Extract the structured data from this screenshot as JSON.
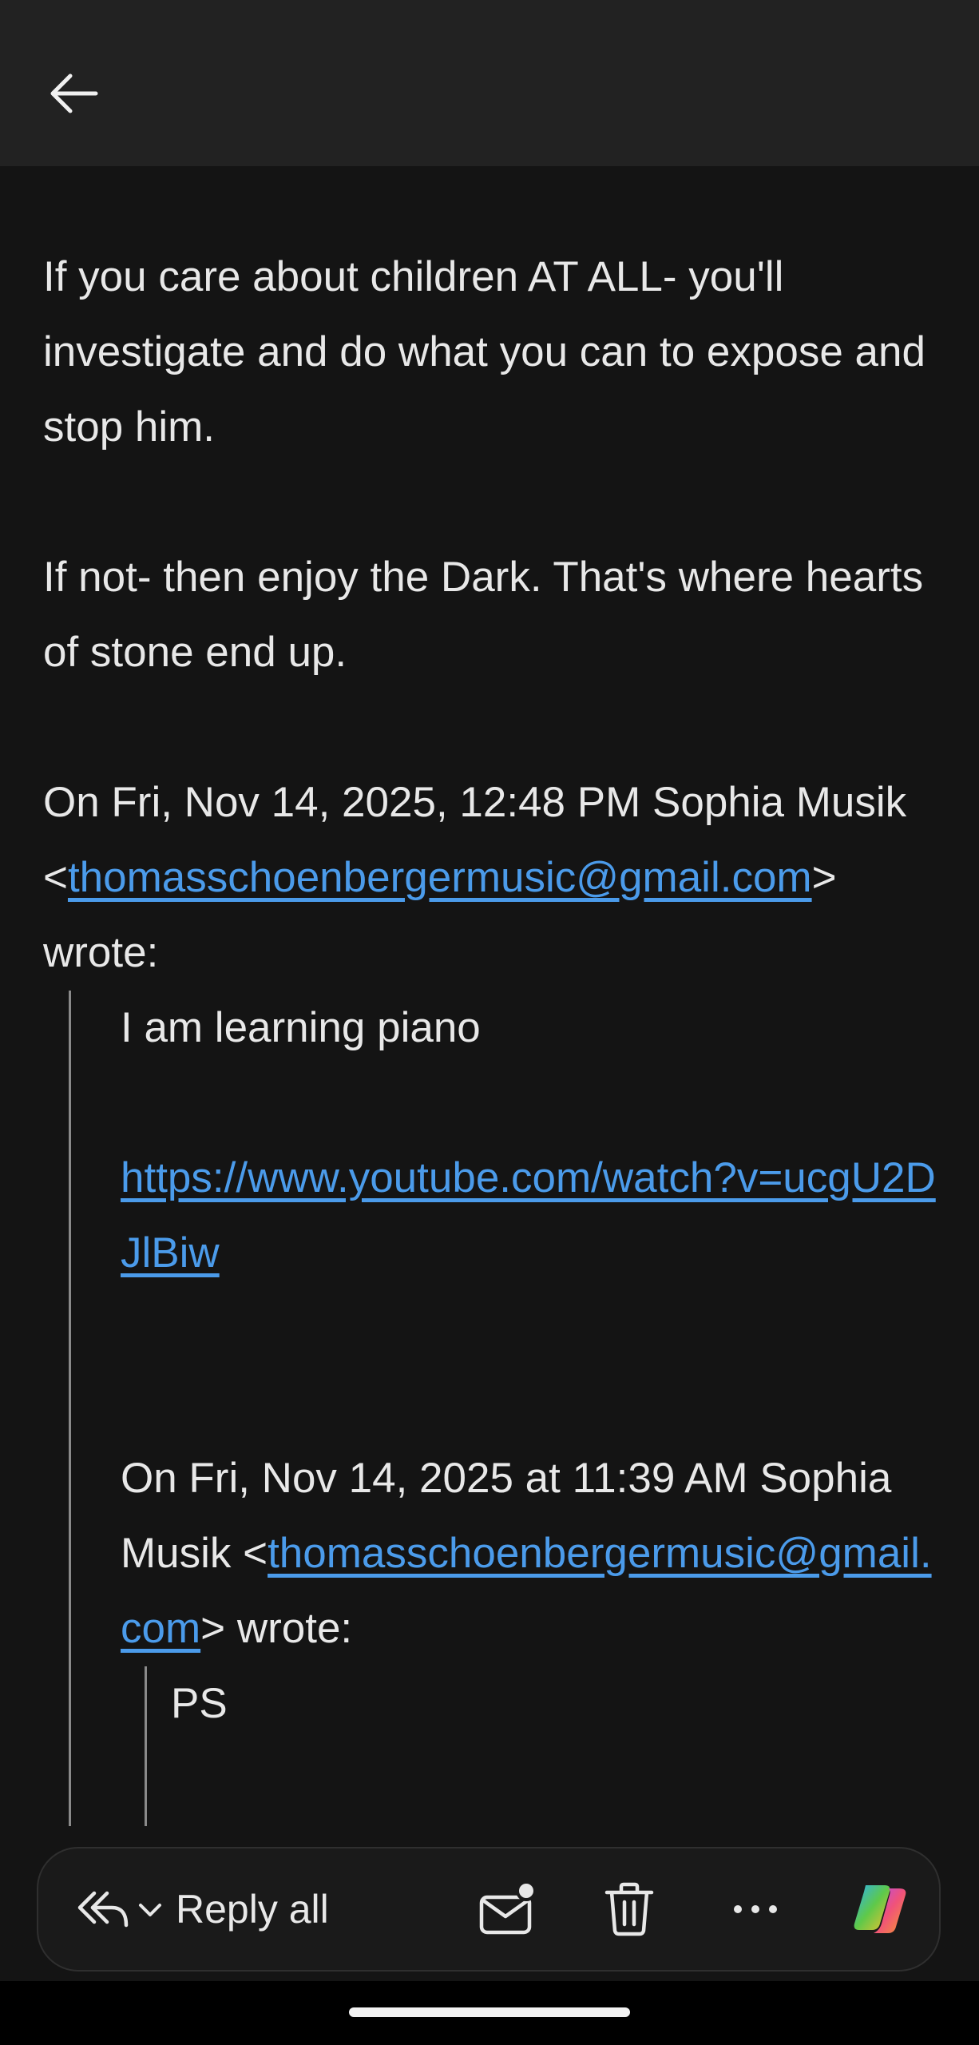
{
  "header": {
    "back_icon": "arrow-left-icon"
  },
  "body": {
    "para1": "If you care about children AT ALL- you'll investigate and do what you can to expose and stop him.",
    "para2": "If not- then enjoy the Dark. That's where hearts of stone end up.",
    "quote_header_1_pre": "On Fri, Nov 14, 2025, 12:48 PM Sophia Musik <",
    "quote_header_1_email": "thomasschoenbergermusic@gmail.com",
    "quote_header_1_post": "> wrote:",
    "quoted": {
      "line1": "I am learning piano",
      "youtube_link": "https://www.youtube.com/watch?v=ucgU2DJlBiw",
      "quote_header_2_pre": "On Fri, Nov 14, 2025 at 11:39 AM Sophia Musik <",
      "quote_header_2_email": "thomasschoenbergermusic@gmail.com",
      "quote_header_2_post": "> wrote:",
      "nested_text": "PS"
    }
  },
  "toolbar": {
    "reply_all_label": "Reply all",
    "icons": [
      "reply-all-icon",
      "chevron-down-icon",
      "mark-unread-icon",
      "delete-icon",
      "more-icon",
      "copilot-icon"
    ]
  }
}
